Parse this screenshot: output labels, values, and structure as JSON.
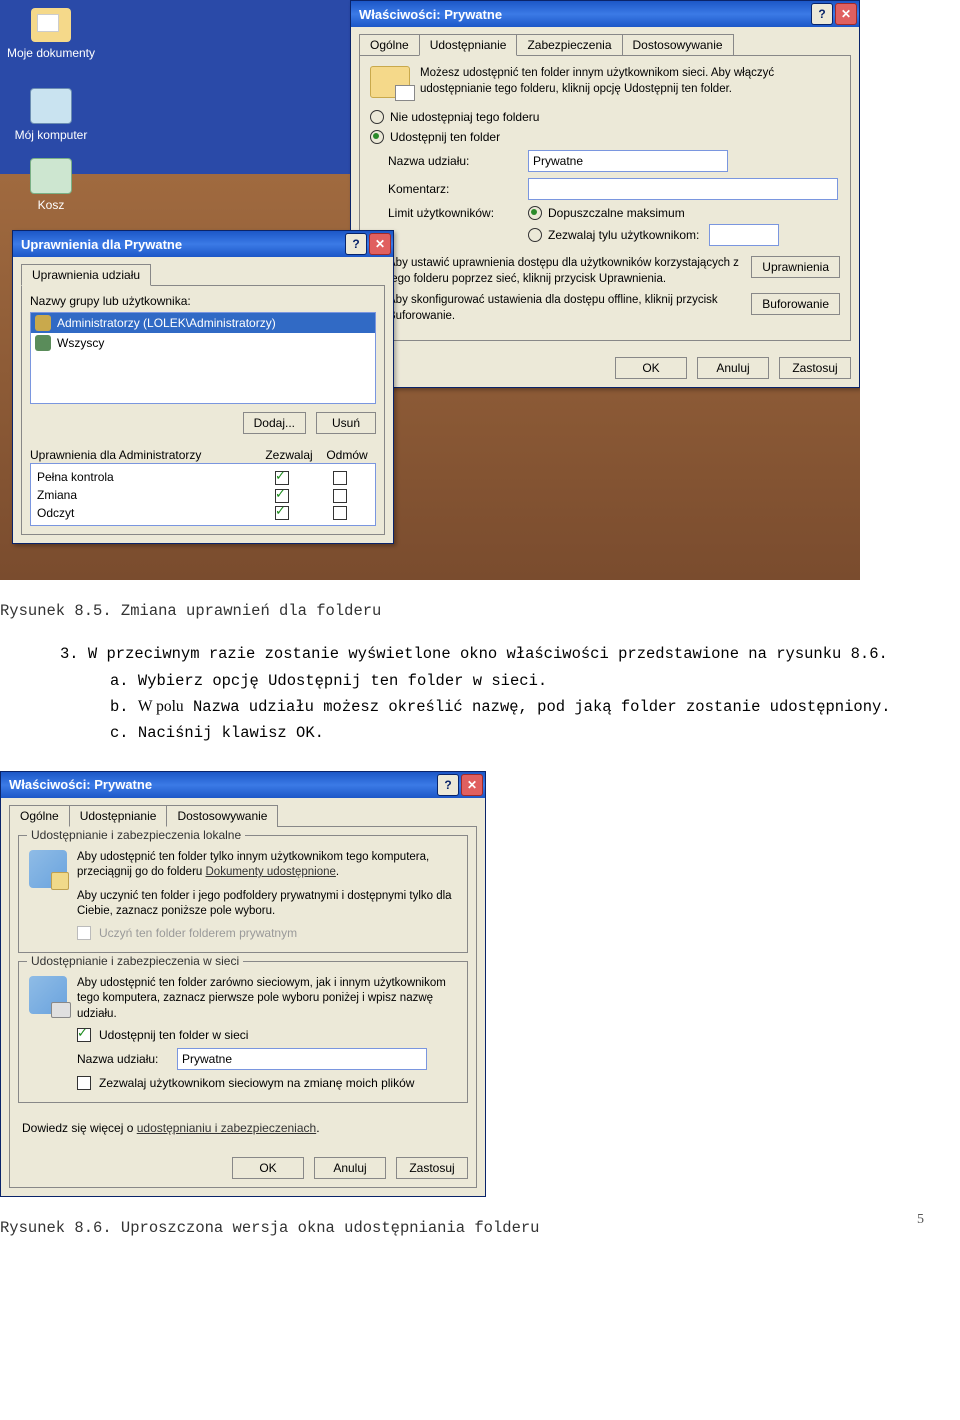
{
  "desktop": {
    "icons": [
      "Moje dokumenty",
      "Mój komputer",
      "Kosz"
    ]
  },
  "props_win": {
    "title": "Właściwości: Prywatne",
    "tabs": [
      "Ogólne",
      "Udostępnianie",
      "Zabezpieczenia",
      "Dostosowywanie"
    ],
    "intro": "Możesz udostępnić ten folder innym użytkownikom sieci. Aby włączyć udostępnianie tego folderu, kliknij opcję Udostępnij ten folder.",
    "radio_no_share": "Nie udostępniaj tego folderu",
    "radio_share": "Udostępnij ten folder",
    "name_label": "Nazwa udziału:",
    "name_value": "Prywatne",
    "comment_label": "Komentarz:",
    "limit_label": "Limit użytkowników:",
    "limit_max": "Dopuszczalne maksimum",
    "limit_only": "Zezwalaj tylu użytkownikom:",
    "perm_text": "Aby ustawić uprawnienia dostępu dla użytkowników korzystających z tego folderu poprzez sieć, kliknij przycisk Uprawnienia.",
    "cache_text": "Aby skonfigurować ustawienia dla dostępu offline, kliknij przycisk Buforowanie.",
    "btn_perm": "Uprawnienia",
    "btn_cache": "Buforowanie",
    "btn_ok": "OK",
    "btn_cancel": "Anuluj",
    "btn_apply": "Zastosuj"
  },
  "perm_win": {
    "title": "Uprawnienia dla Prywatne",
    "tab": "Uprawnienia udziału",
    "names_label": "Nazwy grupy lub użytkownika:",
    "items": [
      "Administratorzy (LOLEK\\Administratorzy)",
      "Wszyscy"
    ],
    "btn_add": "Dodaj...",
    "btn_remove": "Usuń",
    "perms_for": "Uprawnienia dla Administratorzy",
    "col_allow": "Zezwalaj",
    "col_deny": "Odmów",
    "perm_rows": [
      "Pełna kontrola",
      "Zmiana",
      "Odczyt"
    ]
  },
  "caption1": "Rysunek 8.5. Zmiana uprawnień dla folderu",
  "body": {
    "s3": "3. W przeciwnym razie zostanie wyświetlone okno właściwości przedstawione na rysunku 8.6.",
    "sa": "a. Wybierz opcję Udostępnij ten folder w sieci.",
    "sb_pre": "b. ",
    "sb_serif": "W polu",
    "sb_rest": " Nazwa udziału możesz określić nazwę, pod jaką folder zostanie udostępniony.",
    "sc": "c. Naciśnij klawisz OK."
  },
  "props_win2": {
    "title": "Właściwości: Prywatne",
    "tabs": [
      "Ogólne",
      "Udostępnianie",
      "Dostosowywanie"
    ],
    "group1_title": "Udostępnianie i zabezpieczenia lokalne",
    "g1_text1": "Aby udostępnić ten folder tylko innym użytkownikom tego komputera, przeciągnij go do folderu ",
    "g1_link": "Dokumenty udostępnione",
    "g1_text2": "Aby uczynić ten folder i jego podfoldery prywatnymi i dostępnymi tylko dla Ciebie, zaznacz poniższe pole wyboru.",
    "g1_cb": "Uczyń ten folder folderem prywatnym",
    "group2_title": "Udostępnianie i zabezpieczenia w sieci",
    "g2_text": "Aby udostępnić ten folder zarówno sieciowym, jak i innym użytkownikom tego komputera, zaznacz pierwsze pole wyboru poniżej i wpisz nazwę udziału.",
    "g2_cb1": "Udostępnij ten folder w sieci",
    "g2_name_label": "Nazwa udziału:",
    "g2_name_value": "Prywatne",
    "g2_cb2": "Zezwalaj użytkownikom sieciowym na zmianę moich plików",
    "footer_text": "Dowiedz się więcej o ",
    "footer_link": "udostępnianiu i zabezpieczeniach",
    "btn_ok": "OK",
    "btn_cancel": "Anuluj",
    "btn_apply": "Zastosuj"
  },
  "caption2": "Rysunek 8.6. Uproszczona wersja okna udostępniania folderu",
  "page_num": "5"
}
